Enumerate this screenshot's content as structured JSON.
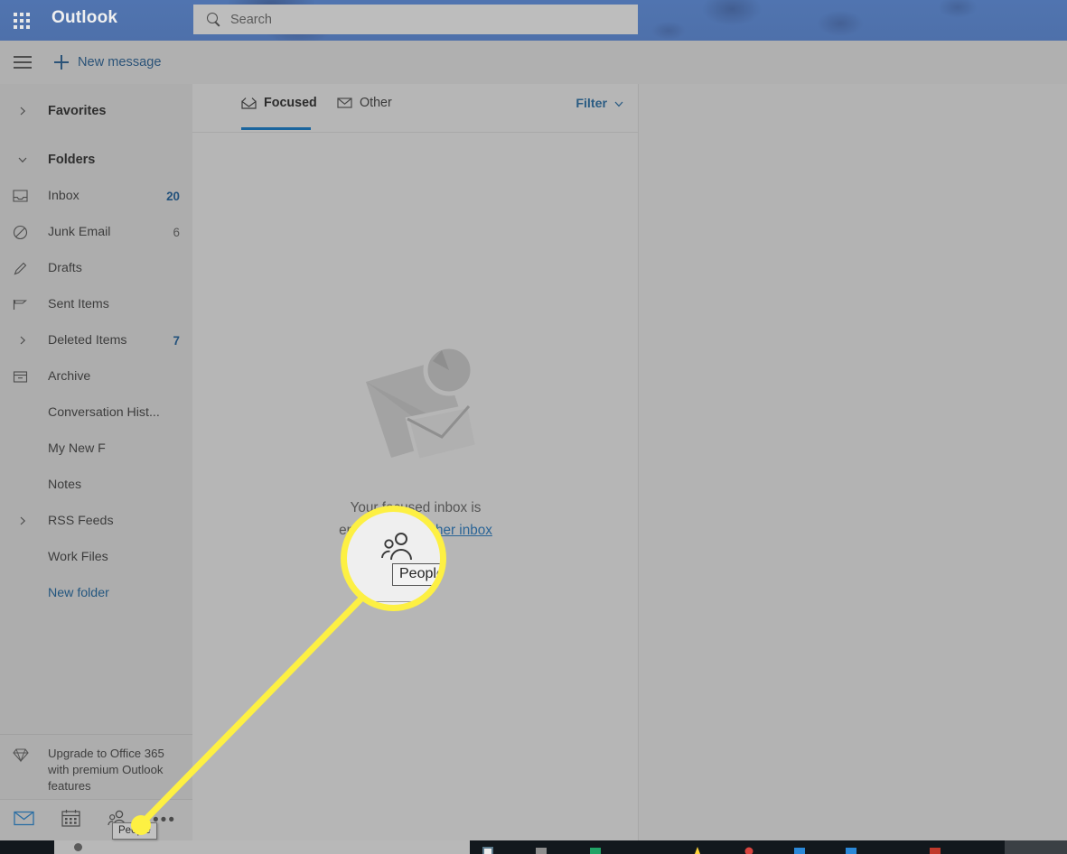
{
  "app": {
    "brand": "Outlook",
    "waffle_icon": "app-launcher-grid-icon"
  },
  "search": {
    "placeholder": "Search",
    "icon": "search-icon"
  },
  "command_bar": {
    "menu_icon": "hamburger-menu-icon",
    "new_message_label": "New message",
    "new_message_icon": "plus-icon"
  },
  "sidebar": {
    "favorites": {
      "label": "Favorites",
      "chevron": "chevron-right-icon"
    },
    "folders_header": {
      "label": "Folders",
      "chevron": "chevron-down-icon"
    },
    "items": [
      {
        "label": "Inbox",
        "count": "20",
        "icon": "inbox-icon",
        "count_highlight": true,
        "chevron": ""
      },
      {
        "label": "Junk Email",
        "count": "6",
        "icon": "block-circle-icon",
        "count_highlight": false,
        "chevron": ""
      },
      {
        "label": "Drafts",
        "count": "",
        "icon": "pencil-icon",
        "count_highlight": false,
        "chevron": ""
      },
      {
        "label": "Sent Items",
        "count": "",
        "icon": "send-flag-icon",
        "count_highlight": false,
        "chevron": ""
      },
      {
        "label": "Deleted Items",
        "count": "7",
        "icon": "",
        "count_highlight": true,
        "chevron": "chevron-right-icon"
      },
      {
        "label": "Archive",
        "count": "",
        "icon": "archive-box-icon",
        "count_highlight": false,
        "chevron": ""
      },
      {
        "label": "Conversation Hist...",
        "count": "",
        "icon": "",
        "count_highlight": false,
        "chevron": ""
      },
      {
        "label": "My New F",
        "count": "",
        "icon": "",
        "count_highlight": false,
        "chevron": ""
      },
      {
        "label": "Notes",
        "count": "",
        "icon": "",
        "count_highlight": false,
        "chevron": ""
      },
      {
        "label": "RSS Feeds",
        "count": "",
        "icon": "",
        "count_highlight": false,
        "chevron": "chevron-right-icon"
      },
      {
        "label": "Work Files",
        "count": "",
        "icon": "",
        "count_highlight": false,
        "chevron": ""
      }
    ],
    "new_folder_label": "New folder",
    "promo": {
      "icon": "diamond-icon",
      "text": "Upgrade to Office 365 with premium Outlook features"
    },
    "app_switcher": {
      "mail_icon": "mail-envelope-icon",
      "calendar_icon": "calendar-icon",
      "people_icon": "people-icon",
      "more_icon": "ellipsis-icon",
      "tooltip": "People"
    }
  },
  "mail_list": {
    "tabs": [
      {
        "label": "Focused",
        "icon": "focused-inbox-icon",
        "selected": true
      },
      {
        "label": "Other",
        "icon": "other-inbox-icon",
        "selected": false
      }
    ],
    "filter": {
      "label": "Filter",
      "chevron": "chevron-down-icon"
    },
    "empty_state": {
      "illustration": "empty-inbox-envelope-illustration",
      "line1": "Your focused inbox is",
      "line2_prefix": "empty. ",
      "line2_link": "Go to Other inbox"
    }
  },
  "annotation": {
    "magnifier_icon": "people-icon",
    "magnifier_tooltip": "People",
    "highlight_color": "#fdf043"
  },
  "colors": {
    "header_blue": "#3a6cc0",
    "accent_blue": "#1a659e",
    "link_blue": "#23567f",
    "sidebar_gray": "#adadad",
    "list_gray": "#b6b6b6",
    "pane_gray": "#b3b3b3"
  }
}
